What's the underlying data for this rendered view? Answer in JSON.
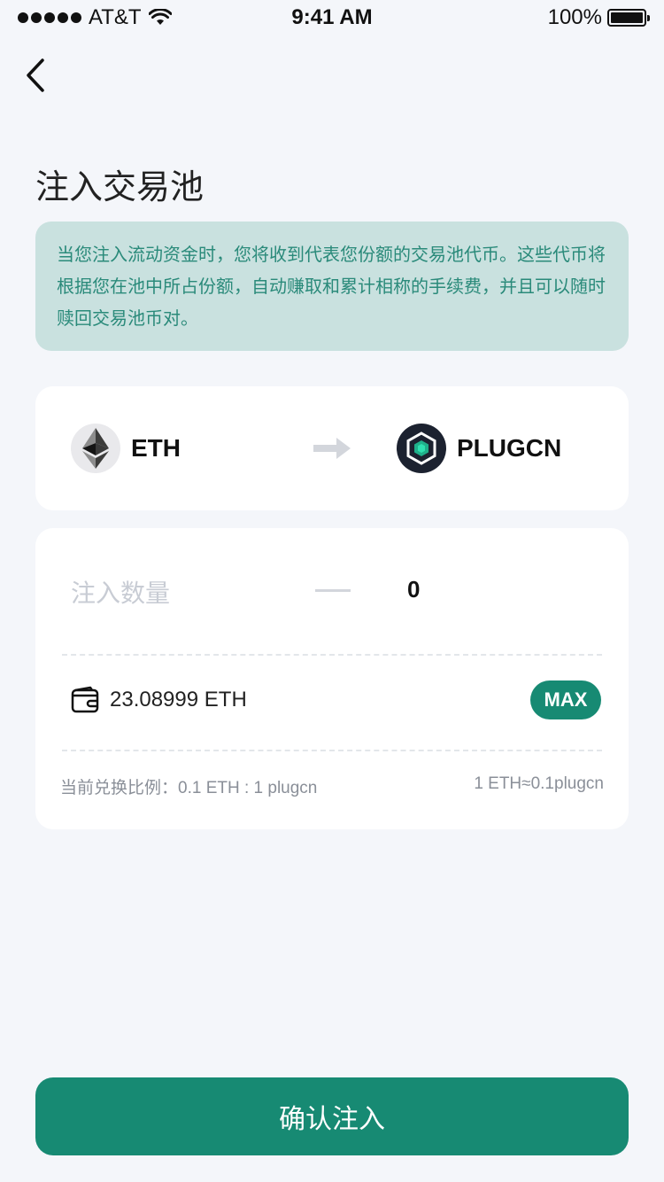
{
  "status_bar": {
    "carrier": "AT&T",
    "time": "9:41 AM",
    "battery": "100%"
  },
  "header": {
    "title": "注入交易池"
  },
  "notice": {
    "text": "当您注入流动资金时，您将收到代表您份额的交易池代币。这些代币将根据您在池中所占份额，自动赚取和累计相称的手续费，并且可以随时赎回交易池币对。"
  },
  "pair": {
    "from": {
      "symbol": "ETH",
      "icon": "ethereum-icon"
    },
    "to": {
      "symbol": "PLUGCN",
      "icon": "plugcn-icon"
    },
    "arrow_icon": "arrow-right-icon"
  },
  "input": {
    "label": "注入数量",
    "value": "0",
    "balance": "23.08999 ETH",
    "max_label": "MAX",
    "wallet_icon": "wallet-icon",
    "rate_left": "当前兑换比例：0.1 ETH : 1 plugcn",
    "rate_right": "1 ETH≈0.1plugcn"
  },
  "confirm": {
    "label": "确认注入"
  },
  "colors": {
    "background": "#f4f6fa",
    "accent": "#178a73",
    "notice_bg": "#c9e1df",
    "notice_text": "#2a8a7a"
  }
}
